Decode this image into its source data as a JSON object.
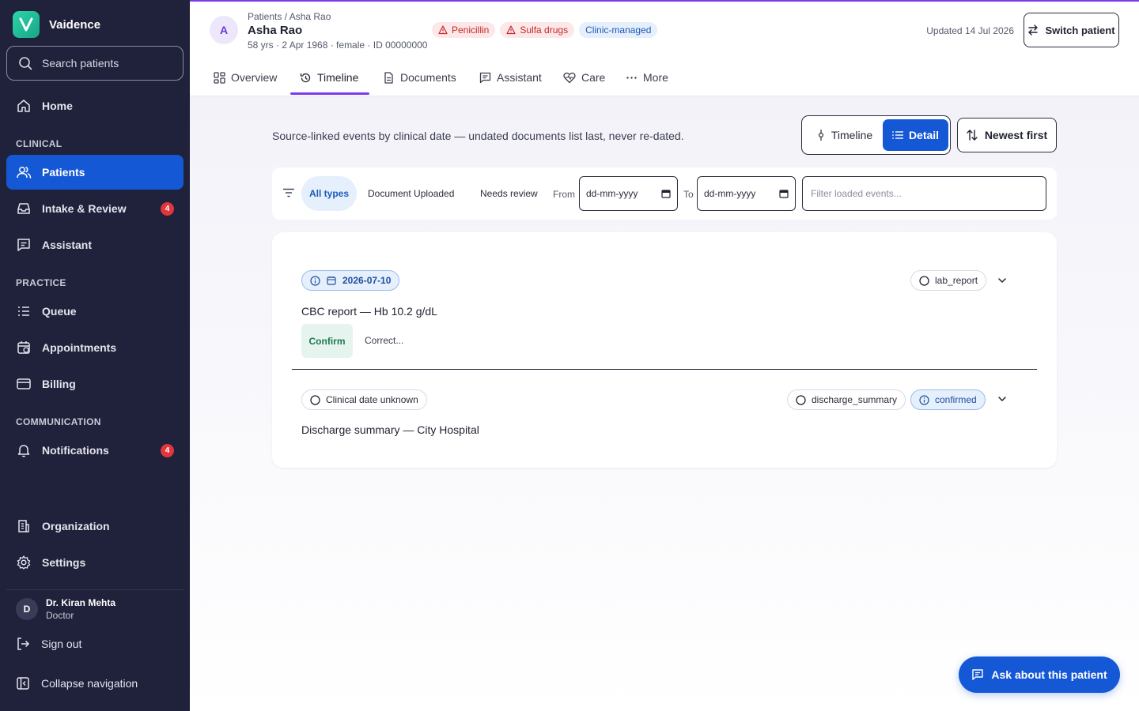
{
  "app": {
    "name": "Vaidence",
    "search_placeholder": "Search patients"
  },
  "sidebar": {
    "home": "Home",
    "sections": {
      "clinical": "CLINICAL",
      "practice": "PRACTICE",
      "communication": "COMMUNICATION"
    },
    "items": {
      "patients": "Patients",
      "intake": "Intake & Review",
      "intake_badge": "4",
      "assistant": "Assistant",
      "queue": "Queue",
      "appointments": "Appointments",
      "billing": "Billing",
      "notifications": "Notifications",
      "notifications_badge": "4",
      "organization": "Organization",
      "settings": "Settings"
    },
    "user": {
      "initial": "D",
      "name": "Dr. Kiran Mehta",
      "role": "Doctor"
    },
    "sign_out": "Sign out",
    "collapse": "Collapse navigation"
  },
  "header": {
    "avatar_initial": "A",
    "breadcrumb": "Patients / Asha Rao",
    "patient_name": "Asha Rao",
    "patient_meta": "58 yrs · 2 Apr 1968 · female · ID 00000000",
    "allergies": [
      "Penicillin",
      "Sulfa drugs"
    ],
    "management_chip": "Clinic-managed",
    "updated": "Updated 14 Jul 2026",
    "switch_label": "Switch patient"
  },
  "tabs": {
    "overview": "Overview",
    "timeline": "Timeline",
    "documents": "Documents",
    "assistant": "Assistant",
    "care": "Care",
    "more": "More",
    "active": "timeline"
  },
  "timeline": {
    "intro": "Source-linked events by clinical date — undated documents list last, never re-dated.",
    "view_toggle": {
      "timeline": "Timeline",
      "detail": "Detail",
      "selected": "detail"
    },
    "sort_label": "Newest first",
    "filters": {
      "all_types": "All types",
      "document_uploaded": "Document Uploaded",
      "needs_review": "Needs review",
      "active": "all_types",
      "from_label": "From",
      "to_label": "To",
      "from_value": "dd-mm-yyyy",
      "to_value": "dd-mm-yyyy",
      "text_placeholder": "Filter loaded events..."
    },
    "events": [
      {
        "date": "2026-07-10",
        "type": "lab_report",
        "title": "CBC report — Hb 10.2 g/dL",
        "confirm_label": "Confirm",
        "correct_label": "Correct..."
      },
      {
        "date": "Clinical date unknown",
        "type": "discharge_summary",
        "status": "confirmed",
        "title": "Discharge summary — City Hospital"
      }
    ]
  },
  "ask_button": "Ask about this patient",
  "colors": {
    "sidebar_bg": "#20213a",
    "primary": "#1558d6",
    "accent_purple": "#7c3aed",
    "allergy_red": "#c62828",
    "badge_red": "#e0363c",
    "confirm_green": "#1c7a4f"
  }
}
